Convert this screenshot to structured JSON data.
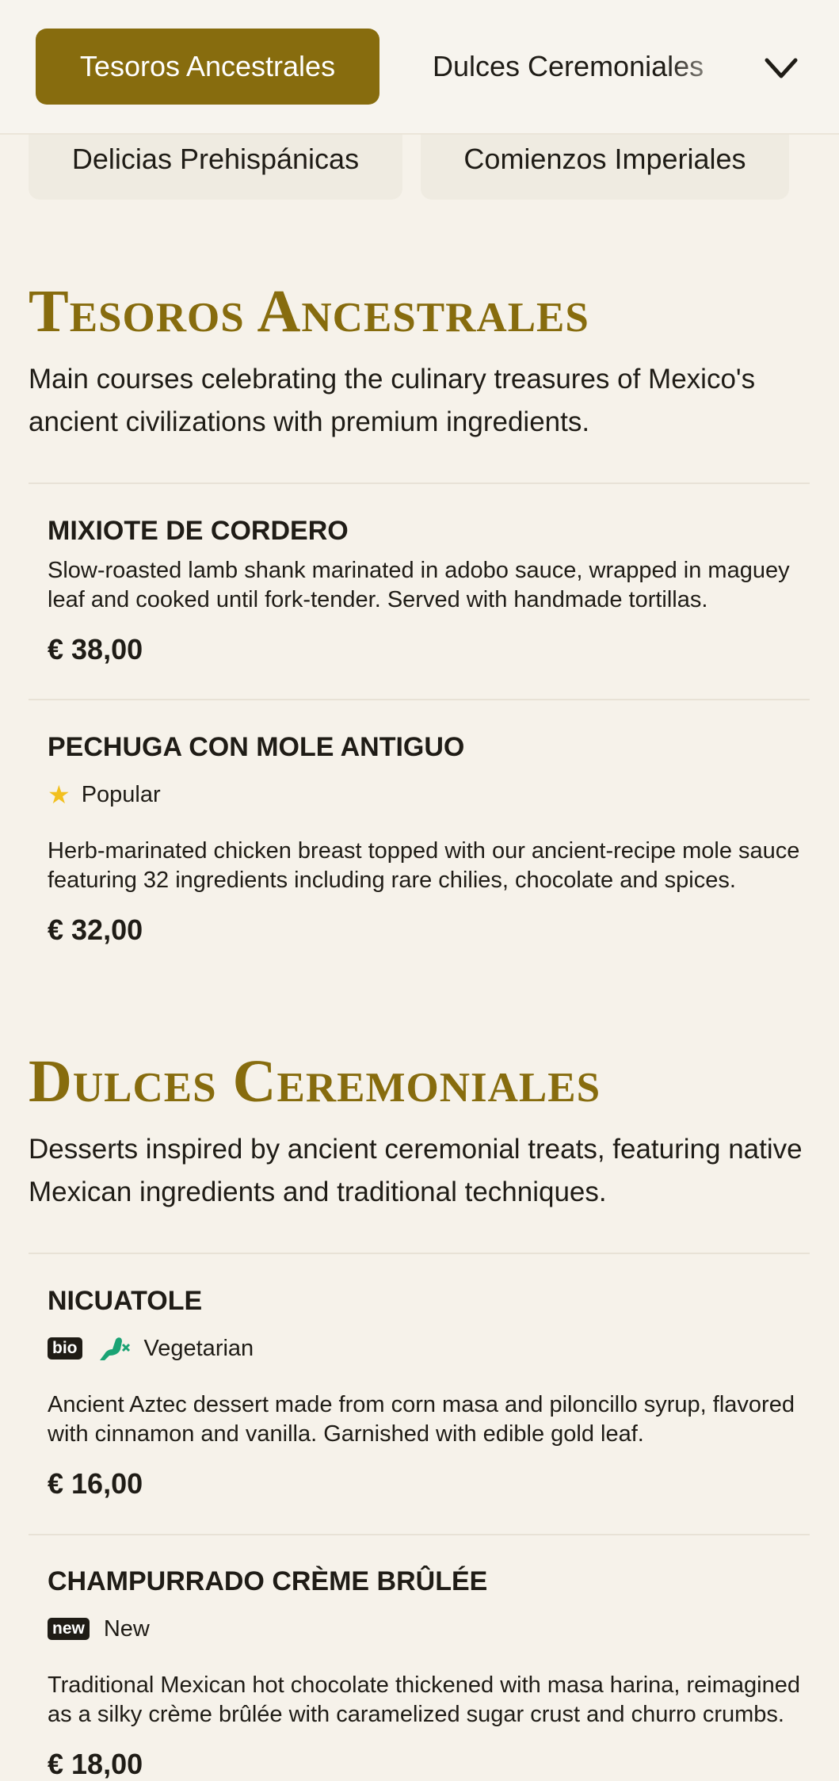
{
  "nav": {
    "active_tab": "Tesoros Ancestrales",
    "next_tab": "Dulces Ceremoniales",
    "chips": [
      "Delicias Prehispánicas",
      "Comienzos Imperiales"
    ],
    "chevron_icon": "chevron-down-icon"
  },
  "sections": [
    {
      "title": "Tesoros Ancestrales",
      "description": "Main courses celebrating the culinary treasures of Mexico's ancient civilizations with premium ingredients.",
      "items": [
        {
          "name": "MIXIOTE DE CORDERO",
          "description": "Slow-roasted lamb shank marinated in adobo sauce, wrapped in maguey leaf and cooked until fork-tender. Served with handmade tortillas.",
          "price": "€ 38,00"
        },
        {
          "name": "PECHUGA CON MOLE ANTIGUO",
          "tag_label": "Popular",
          "tag_icon": "star-icon",
          "description": "Herb-marinated chicken breast topped with our ancient-recipe mole sauce featuring 32 ingredients including rare chilies, chocolate and spices.",
          "price": "€ 32,00"
        }
      ]
    },
    {
      "title": "Dulces Ceremoniales",
      "description": "Desserts inspired by ancient ceremonial treats, featuring native Mexican ingredients and traditional techniques.",
      "items": [
        {
          "name": "NICUATOLE",
          "badge": "bio",
          "tag_label": "Vegetarian",
          "tag_icon": "vegetarian-leg-icon",
          "description": "Ancient Aztec dessert made from corn masa and piloncillo syrup, flavored with cinnamon and vanilla. Garnished with edible gold leaf.",
          "price": "€ 16,00"
        },
        {
          "name": "CHAMPURRADO CRÈME BRÛLÉE",
          "badge": "new",
          "tag_label": "New",
          "description": "Traditional Mexican hot chocolate thickened with masa harina, reimagined as a silky crème brûlée with caramelized sugar crust and churro crumbs.",
          "price": "€ 18,00"
        }
      ]
    }
  ],
  "colors": {
    "accent": "#876c0e",
    "background": "#f6f2ea",
    "chip_bg": "#efebe1",
    "star": "#f2c01f",
    "vegetarian": "#1aa374"
  }
}
